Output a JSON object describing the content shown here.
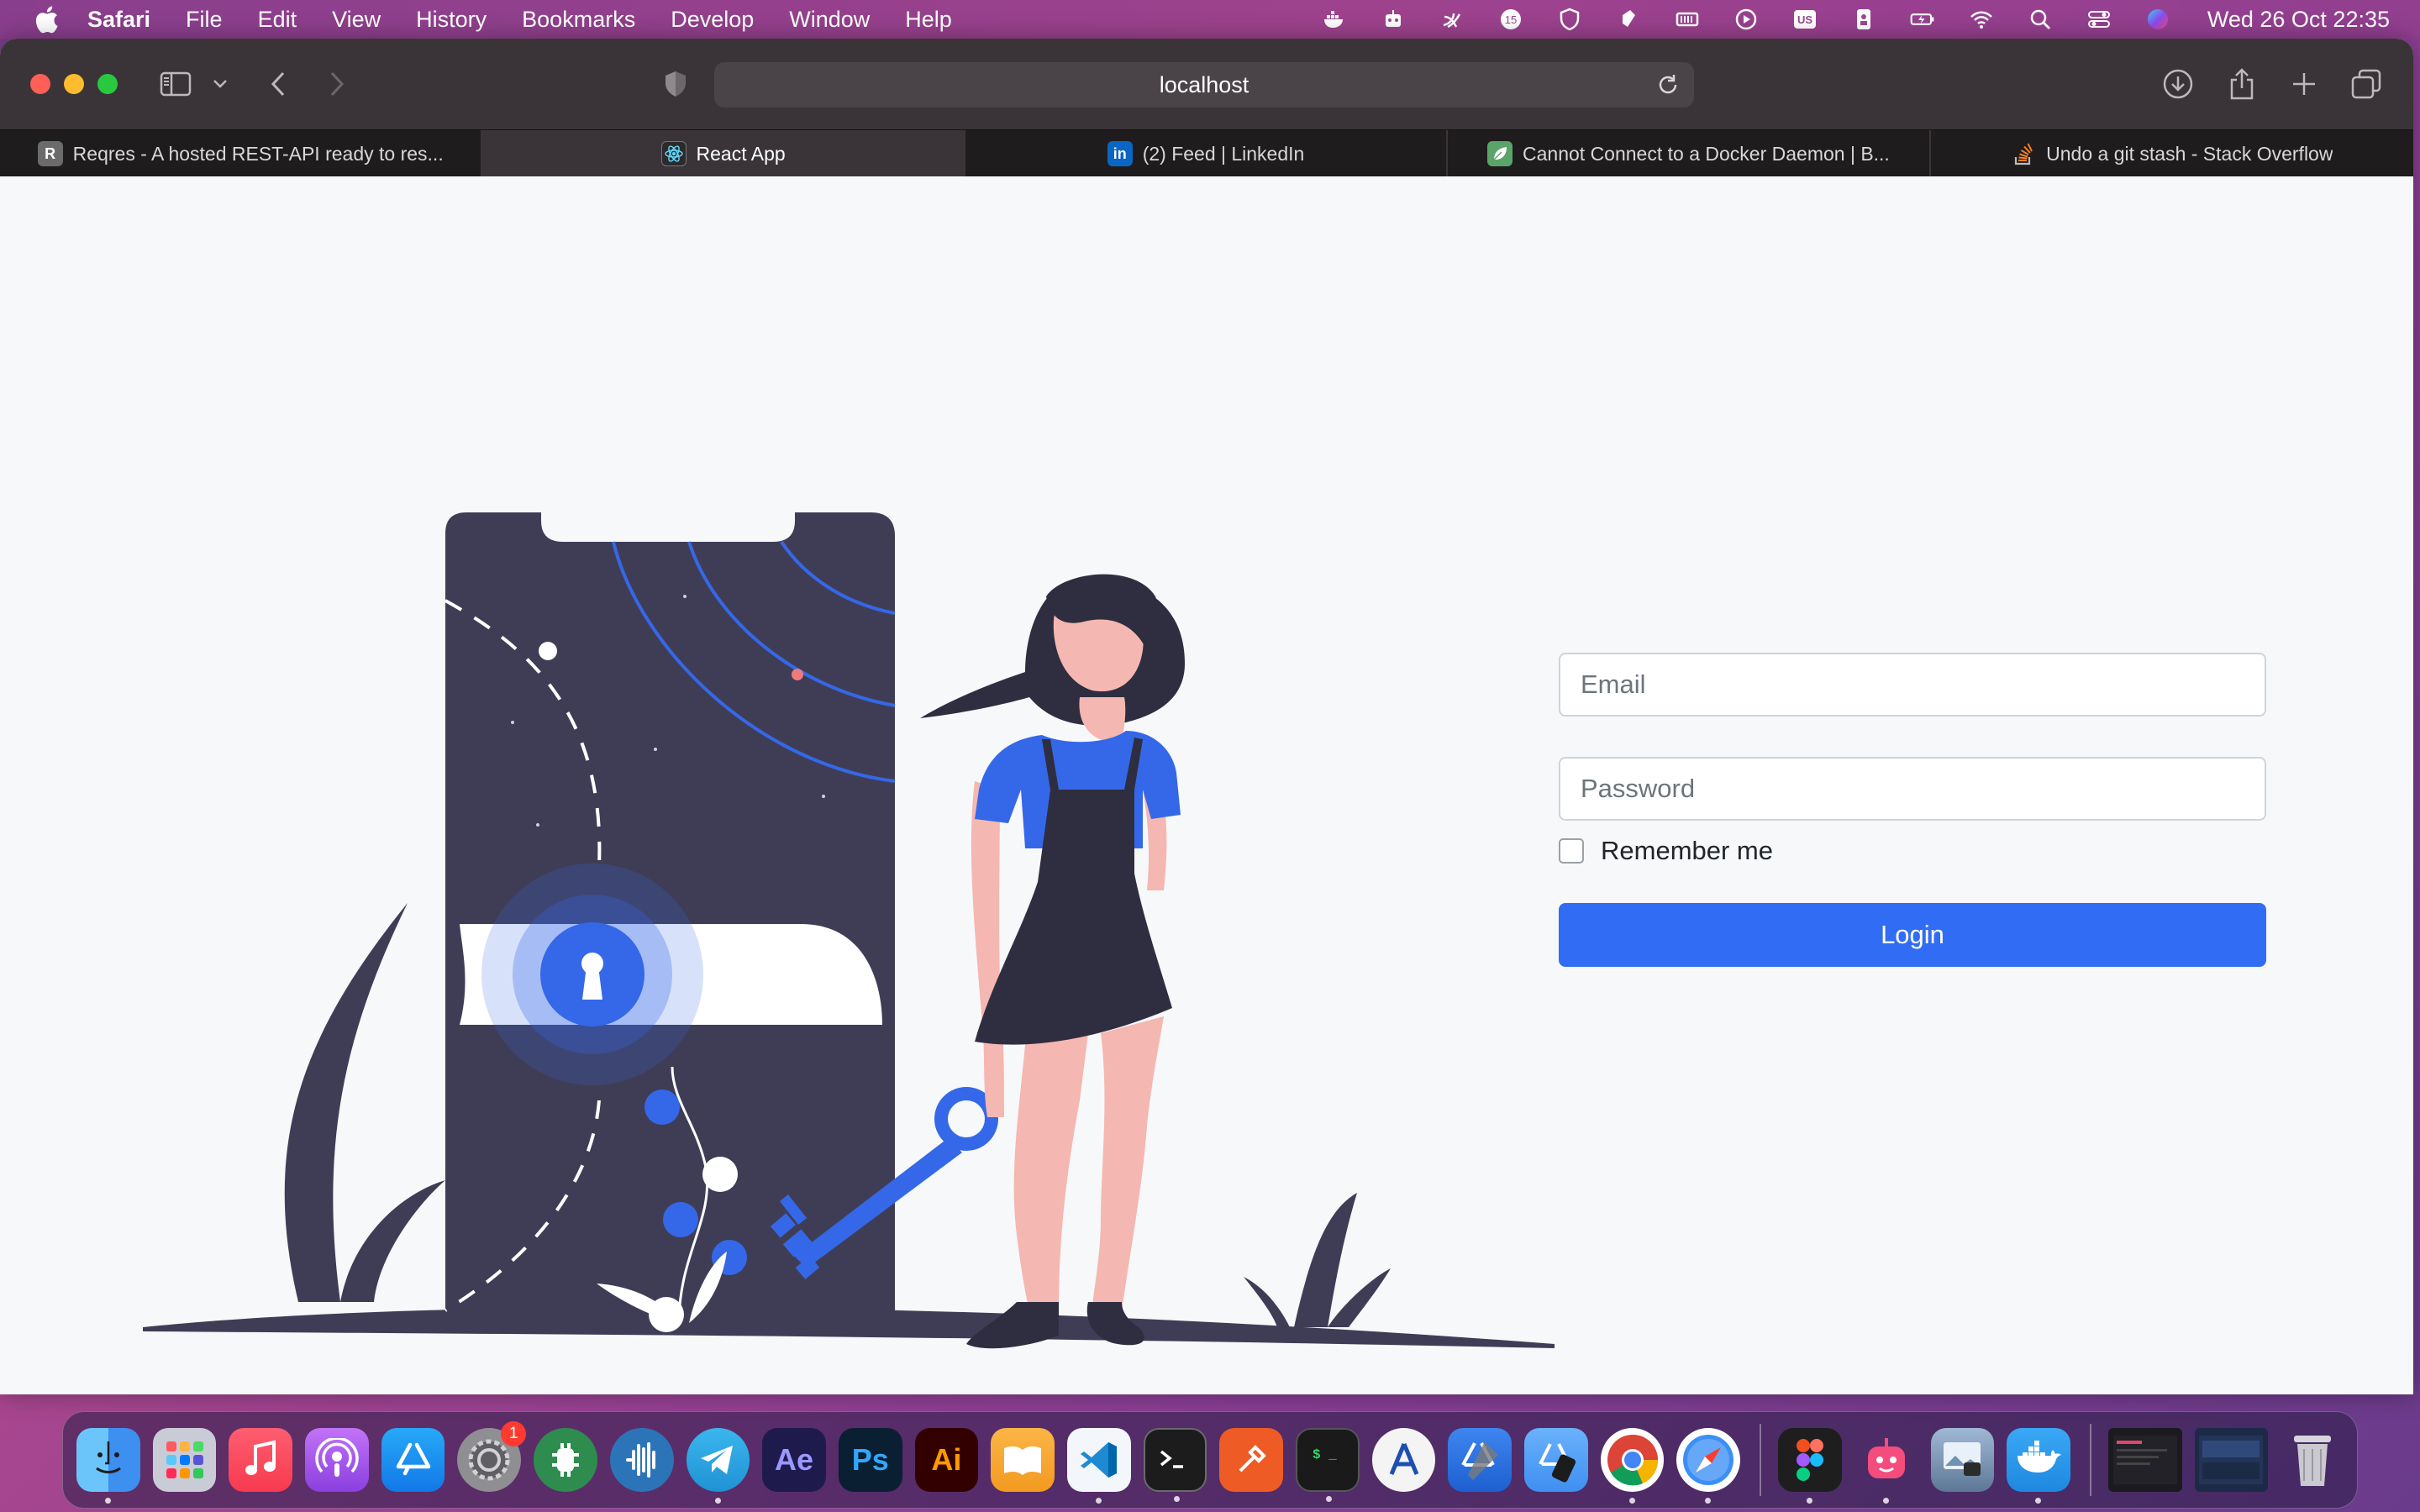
{
  "menubar": {
    "items": [
      "Safari",
      "File",
      "Edit",
      "View",
      "History",
      "Bookmarks",
      "Develop",
      "Window",
      "Help"
    ],
    "clock": "Wed 26 Oct  22:35",
    "badge_count": "15",
    "keyboard_layout": "US"
  },
  "toolbar": {
    "address": "localhost"
  },
  "tabs": [
    {
      "title": "Reqres - A hosted REST-API ready to res...",
      "favicon": "R",
      "favicon_color": "#6b6b6b"
    },
    {
      "title": "React App",
      "favicon": "react-icon",
      "favicon_color": "#2b2b2b"
    },
    {
      "title": "(2) Feed | LinkedIn",
      "favicon": "in",
      "favicon_color": "#0a66c2"
    },
    {
      "title": "Cannot Connect to a Docker Daemon | B...",
      "favicon": "leaf-icon",
      "favicon_color": "#5aa46a"
    },
    {
      "title": "Undo a git stash - Stack Overflow",
      "favicon": "stackoverflow-icon",
      "favicon_color": "#f48024"
    }
  ],
  "form": {
    "email_placeholder": "Email",
    "password_placeholder": "Password",
    "remember_label": "Remember me",
    "login_label": "Login"
  },
  "colors": {
    "accent": "#316cf4",
    "illustration_dark": "#3f3d56",
    "skin": "#f5b7b1"
  },
  "dock": {
    "apps": [
      {
        "name": "Finder",
        "icon": "finder-icon",
        "color": "#3d8ff0",
        "running": true
      },
      {
        "name": "Launchpad",
        "icon": "launchpad-icon",
        "color": "#c9ccd6",
        "running": false
      },
      {
        "name": "Music",
        "icon": "music-icon",
        "color": "#fa3c55",
        "running": false
      },
      {
        "name": "Podcasts",
        "icon": "podcasts-icon",
        "color": "#9a4ff0",
        "running": false
      },
      {
        "name": "App Store",
        "icon": "appstore-icon",
        "color": "#1d8cf5",
        "running": false
      },
      {
        "name": "System Preferences",
        "icon": "settings-icon",
        "color": "#8e8e93",
        "running": false,
        "badge": "1"
      },
      {
        "name": "App",
        "icon": "green-gear-icon",
        "color": "#2f8c4f",
        "running": false
      },
      {
        "name": "App",
        "icon": "audio-icon",
        "color": "#2c74b8",
        "running": false
      },
      {
        "name": "Telegram",
        "icon": "telegram-icon",
        "color": "#2aa3e0",
        "running": true
      },
      {
        "name": "After Effects",
        "icon": "ae-icon",
        "label": "Ae",
        "color": "#1f1a4c",
        "text_color": "#9999ff",
        "running": false
      },
      {
        "name": "Photoshop",
        "icon": "ps-icon",
        "label": "Ps",
        "color": "#0b1f33",
        "text_color": "#31a8ff",
        "running": false
      },
      {
        "name": "Illustrator",
        "icon": "ai-icon",
        "label": "Ai",
        "color": "#330000",
        "text_color": "#ff9a00",
        "running": false
      },
      {
        "name": "Books",
        "icon": "books-icon",
        "color": "#f39a21",
        "running": false
      },
      {
        "name": "VS Code",
        "icon": "vscode-icon",
        "color": "#f3f6fb",
        "running": true
      },
      {
        "name": "Terminal",
        "icon": "terminal-icon",
        "color": "#1c1c1c",
        "running": true
      },
      {
        "name": "Postman",
        "icon": "postman-icon",
        "color": "#ef5b25",
        "running": false
      },
      {
        "name": "iTerm",
        "icon": "iterm-icon",
        "color": "#1a1a1a",
        "running": true
      },
      {
        "name": "Xcode Instruments",
        "icon": "instruments-icon",
        "color": "#f4f4f4",
        "running": false
      },
      {
        "name": "Xcode",
        "icon": "xcode-icon",
        "color": "#2d6fe0",
        "running": false
      },
      {
        "name": "Simulator",
        "icon": "simulator-icon",
        "color": "#4d9df8",
        "running": false
      },
      {
        "name": "Chrome",
        "icon": "chrome-icon",
        "color": "#ffffff",
        "running": true
      },
      {
        "name": "Safari",
        "icon": "safari-icon",
        "color": "#3b8ff5",
        "running": true
      },
      {
        "name": "Figma",
        "icon": "figma-icon",
        "color": "#1e1e1e",
        "running": true
      },
      {
        "name": "App",
        "icon": "robot-icon",
        "color": "#f34c7d",
        "running": true
      },
      {
        "name": "Preview",
        "icon": "preview-icon",
        "color": "#7d96b3",
        "running": false
      },
      {
        "name": "Docker",
        "icon": "docker-icon",
        "color": "#2496ed",
        "running": true
      }
    ]
  }
}
